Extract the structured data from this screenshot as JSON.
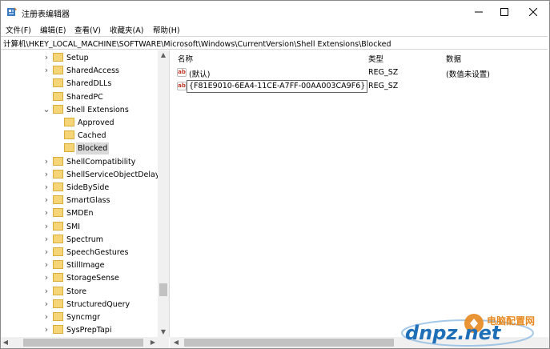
{
  "window": {
    "title": "注册表编辑器",
    "controls": {
      "minimize": "—",
      "maximize": "☐",
      "close": "✕"
    }
  },
  "menu": [
    "文件(F)",
    "编辑(E)",
    "查看(V)",
    "收藏夹(A)",
    "帮助(H)"
  ],
  "address": "计算机\\HKEY_LOCAL_MACHINE\\SOFTWARE\\Microsoft\\Windows\\CurrentVersion\\Shell Extensions\\Blocked",
  "tree": [
    {
      "label": "Setup",
      "indent": 1,
      "chevron": ">"
    },
    {
      "label": "SharedAccess",
      "indent": 1,
      "chevron": ">"
    },
    {
      "label": "SharedDLLs",
      "indent": 1,
      "chevron": ""
    },
    {
      "label": "SharedPC",
      "indent": 1,
      "chevron": ""
    },
    {
      "label": "Shell Extensions",
      "indent": 1,
      "chevron": "v"
    },
    {
      "label": "Approved",
      "indent": 2,
      "chevron": ""
    },
    {
      "label": "Cached",
      "indent": 2,
      "chevron": ""
    },
    {
      "label": "Blocked",
      "indent": 2,
      "chevron": "",
      "selected": true
    },
    {
      "label": "ShellCompatibility",
      "indent": 1,
      "chevron": ">"
    },
    {
      "label": "ShellServiceObjectDelayl",
      "indent": 1,
      "chevron": ">"
    },
    {
      "label": "SideBySide",
      "indent": 1,
      "chevron": ">"
    },
    {
      "label": "SmartGlass",
      "indent": 1,
      "chevron": ">"
    },
    {
      "label": "SMDEn",
      "indent": 1,
      "chevron": ">"
    },
    {
      "label": "SMI",
      "indent": 1,
      "chevron": ">"
    },
    {
      "label": "Spectrum",
      "indent": 1,
      "chevron": ">"
    },
    {
      "label": "SpeechGestures",
      "indent": 1,
      "chevron": ">"
    },
    {
      "label": "StillImage",
      "indent": 1,
      "chevron": ">"
    },
    {
      "label": "StorageSense",
      "indent": 1,
      "chevron": ">"
    },
    {
      "label": "Store",
      "indent": 1,
      "chevron": ">"
    },
    {
      "label": "StructuredQuery",
      "indent": 1,
      "chevron": ">"
    },
    {
      "label": "Syncmgr",
      "indent": 1,
      "chevron": ">"
    },
    {
      "label": "SysPrepTapi",
      "indent": 1,
      "chevron": ">"
    }
  ],
  "columns": {
    "name": "名称",
    "type": "类型",
    "data": "数据"
  },
  "values": [
    {
      "icon": "ab",
      "name": "(默认)",
      "type": "REG_SZ",
      "data": "(数值未设置)",
      "editing": false
    },
    {
      "icon": "ab",
      "name": "{F81E9010-6EA4-11CE-A7FF-00AA003CA9F6}",
      "type": "REG_SZ",
      "data": "",
      "editing": true
    }
  ],
  "watermark": {
    "brand": "dnpz.net",
    "tagline": "电脑配置网"
  },
  "colors": {
    "folder": "#f5d578",
    "selection": "#d9d9d9",
    "watermark_blue": "#1f6fb8",
    "watermark_orange": "#e8891f"
  }
}
